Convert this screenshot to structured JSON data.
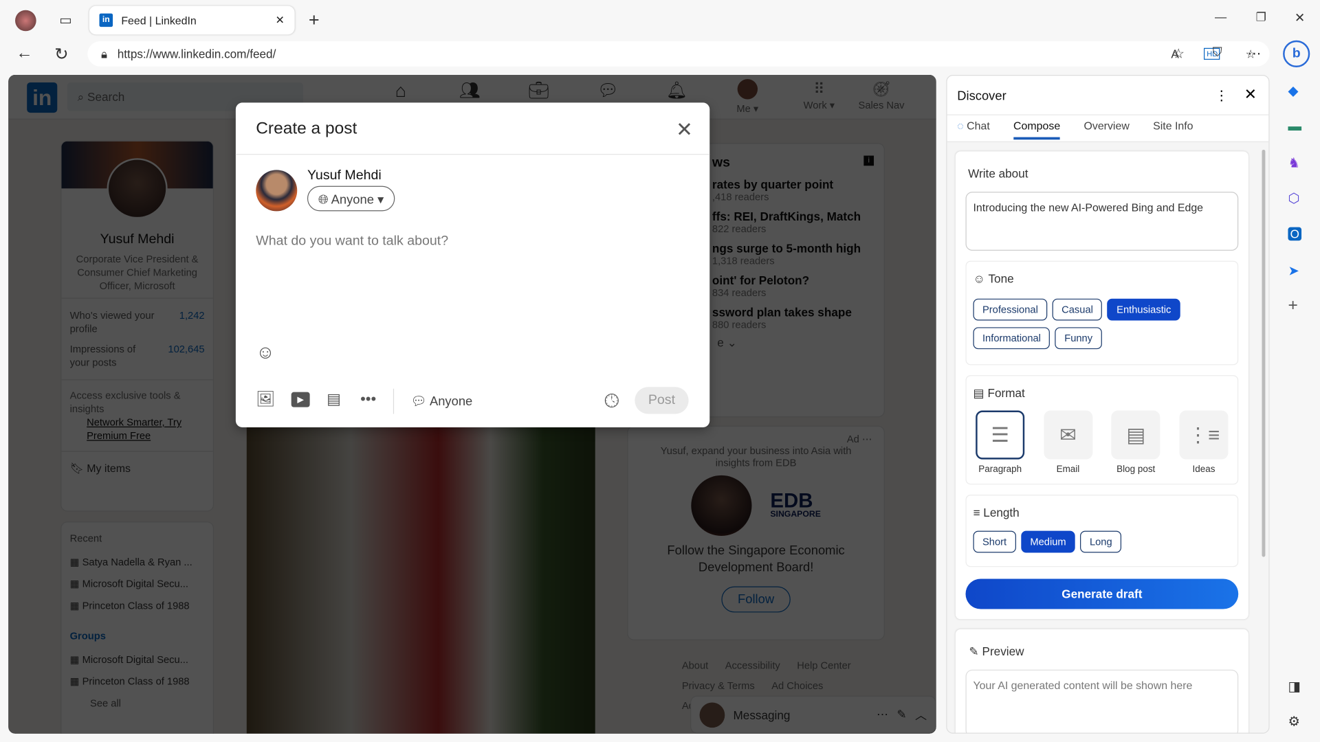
{
  "browser": {
    "tab_title": "Feed | LinkedIn",
    "url": "https://www.linkedin.com/feed/"
  },
  "linkedin": {
    "search_placeholder": "Search",
    "nav": {
      "me": "Me",
      "work": "Work",
      "sales_nav": "Sales Nav"
    },
    "profile": {
      "name": "Yusuf Mehdi",
      "headline": "Corporate Vice President & Consumer Chief Marketing Officer, Microsoft",
      "stats": [
        {
          "label": "Who's viewed your profile",
          "value": "1,242"
        },
        {
          "label": "Impressions of your posts",
          "value": "102,645"
        }
      ],
      "premium_text": "Access exclusive tools & insights",
      "premium_link": "Network Smarter, Try Premium Free",
      "my_items": "My items"
    },
    "recent": {
      "title": "Recent",
      "items": [
        "Satya Nadella & Ryan ...",
        "Microsoft Digital Secu...",
        "Princeton Class of 1988"
      ]
    },
    "groups": {
      "title": "Groups",
      "items": [
        "Microsoft Digital Secu...",
        "Princeton Class of 1988"
      ],
      "see_all": "See all"
    },
    "news": {
      "title": "ws",
      "items": [
        {
          "t": "rates by quarter point",
          "r": ",418 readers"
        },
        {
          "t": "ffs: REI, DraftKings, Match",
          "r": "822 readers"
        },
        {
          "t": "ngs surge to 5-month high",
          "r": "1,318 readers"
        },
        {
          "t": "oint' for Peloton?",
          "r": "834 readers"
        },
        {
          "t": "ssword plan takes shape",
          "r": "880 readers"
        }
      ],
      "show_more": "e"
    },
    "ad": {
      "label": "Ad",
      "text": "Yusuf, expand your business into Asia with insights from EDB",
      "brand": "EDB",
      "brand_sub": "SINGAPORE",
      "cta_text": "Follow the Singapore Economic Development Board!",
      "follow": "Follow"
    },
    "footer": [
      "About",
      "Accessibility",
      "Help Center",
      "Privacy & Terms",
      "Ad Choices",
      "Ad"
    ],
    "messaging": "Messaging"
  },
  "modal": {
    "title": "Create a post",
    "author": "Yusuf Mehdi",
    "audience": "Anyone",
    "placeholder": "What do you want to talk about?",
    "comment_audience": "Anyone",
    "post": "Post"
  },
  "discover": {
    "title": "Discover",
    "tabs": [
      "Chat",
      "Compose",
      "Overview",
      "Site Info"
    ],
    "active_tab": "Compose",
    "write_about_label": "Write about",
    "write_about_value": "Introducing the new AI-Powered Bing and Edge",
    "tone_label": "Tone",
    "tones": [
      "Professional",
      "Casual",
      "Enthusiastic",
      "Informational",
      "Funny"
    ],
    "tone_selected": "Enthusiastic",
    "format_label": "Format",
    "formats": [
      "Paragraph",
      "Email",
      "Blog post",
      "Ideas"
    ],
    "format_selected": "Paragraph",
    "length_label": "Length",
    "lengths": [
      "Short",
      "Medium",
      "Long"
    ],
    "length_selected": "Medium",
    "generate": "Generate draft",
    "preview_label": "Preview",
    "preview_placeholder": "Your AI generated content will be shown here"
  },
  "colors": {
    "accent": "#0f47c9",
    "linkedin_blue": "#0a66c2"
  }
}
